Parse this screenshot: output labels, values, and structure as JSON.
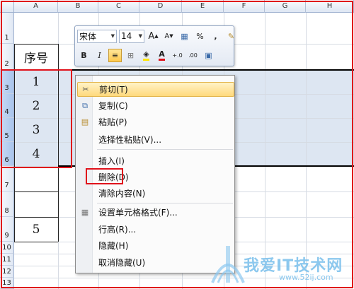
{
  "columns": [
    "A",
    "B",
    "C",
    "D",
    "E",
    "F",
    "G",
    "H"
  ],
  "rows": [
    "1",
    "2",
    "3",
    "4",
    "5",
    "6",
    "7",
    "8",
    "9",
    "10",
    "11",
    "12",
    "13"
  ],
  "cells": {
    "a2": "序号",
    "a3": "1",
    "a4": "2",
    "a5": "3",
    "a6": "4",
    "a9": "5"
  },
  "toolbar": {
    "font_name": "宋体",
    "font_size": "14",
    "grow_font": "A",
    "shrink_font": "A",
    "percent": "%",
    "comma": ",",
    "bold": "B",
    "italic": "I",
    "font_color": "A",
    "increase_decimal": "+.0",
    "decrease_decimal": ".00"
  },
  "context_menu": {
    "items": [
      {
        "label": "剪切(T)"
      },
      {
        "label": "复制(C)"
      },
      {
        "label": "粘贴(P)"
      },
      {
        "label": "选择性粘贴(V)..."
      },
      {
        "label": "插入(I)"
      },
      {
        "label": "删除(D)"
      },
      {
        "label": "清除内容(N)"
      },
      {
        "label": "设置单元格格式(F)..."
      },
      {
        "label": "行高(R)..."
      },
      {
        "label": "隐藏(H)"
      },
      {
        "label": "取消隐藏(U)"
      }
    ]
  },
  "watermark": {
    "title": "我爱IT技术网",
    "url": "www.52ij.com"
  },
  "colors": {
    "highlight_red": "#e0121b",
    "selection_fill": "#dde6f2",
    "menu_hover": "#ffd97c"
  }
}
